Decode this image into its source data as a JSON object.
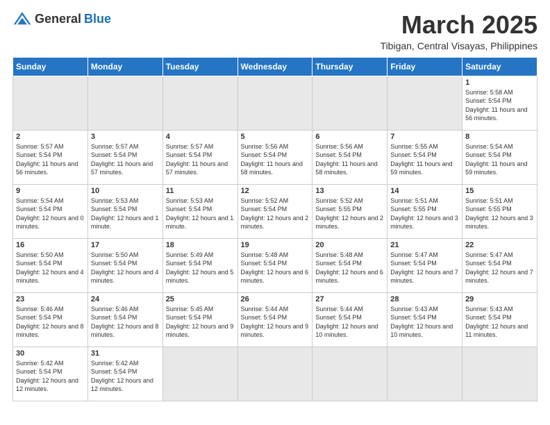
{
  "logo": {
    "general": "General",
    "blue": "Blue"
  },
  "title": "March 2025",
  "subtitle": "Tibigan, Central Visayas, Philippines",
  "weekdays": [
    "Sunday",
    "Monday",
    "Tuesday",
    "Wednesday",
    "Thursday",
    "Friday",
    "Saturday"
  ],
  "weeks": [
    [
      {
        "day": "",
        "empty": true
      },
      {
        "day": "",
        "empty": true
      },
      {
        "day": "",
        "empty": true
      },
      {
        "day": "",
        "empty": true
      },
      {
        "day": "",
        "empty": true
      },
      {
        "day": "",
        "empty": true
      },
      {
        "day": "1",
        "sunrise": "5:58 AM",
        "sunset": "5:54 PM",
        "daylight": "11 hours and 56 minutes."
      }
    ],
    [
      {
        "day": "2",
        "sunrise": "5:57 AM",
        "sunset": "5:54 PM",
        "daylight": "11 hours and 56 minutes."
      },
      {
        "day": "3",
        "sunrise": "5:57 AM",
        "sunset": "5:54 PM",
        "daylight": "11 hours and 57 minutes."
      },
      {
        "day": "4",
        "sunrise": "5:57 AM",
        "sunset": "5:54 PM",
        "daylight": "11 hours and 57 minutes."
      },
      {
        "day": "5",
        "sunrise": "5:56 AM",
        "sunset": "5:54 PM",
        "daylight": "11 hours and 58 minutes."
      },
      {
        "day": "6",
        "sunrise": "5:56 AM",
        "sunset": "5:54 PM",
        "daylight": "11 hours and 58 minutes."
      },
      {
        "day": "7",
        "sunrise": "5:55 AM",
        "sunset": "5:54 PM",
        "daylight": "11 hours and 59 minutes."
      },
      {
        "day": "8",
        "sunrise": "5:54 AM",
        "sunset": "5:54 PM",
        "daylight": "11 hours and 59 minutes."
      }
    ],
    [
      {
        "day": "9",
        "sunrise": "5:54 AM",
        "sunset": "5:54 PM",
        "daylight": "12 hours and 0 minutes."
      },
      {
        "day": "10",
        "sunrise": "5:53 AM",
        "sunset": "5:54 PM",
        "daylight": "12 hours and 1 minute."
      },
      {
        "day": "11",
        "sunrise": "5:53 AM",
        "sunset": "5:54 PM",
        "daylight": "12 hours and 1 minute."
      },
      {
        "day": "12",
        "sunrise": "5:52 AM",
        "sunset": "5:54 PM",
        "daylight": "12 hours and 2 minutes."
      },
      {
        "day": "13",
        "sunrise": "5:52 AM",
        "sunset": "5:55 PM",
        "daylight": "12 hours and 2 minutes."
      },
      {
        "day": "14",
        "sunrise": "5:51 AM",
        "sunset": "5:55 PM",
        "daylight": "12 hours and 3 minutes."
      },
      {
        "day": "15",
        "sunrise": "5:51 AM",
        "sunset": "5:55 PM",
        "daylight": "12 hours and 3 minutes."
      }
    ],
    [
      {
        "day": "16",
        "sunrise": "5:50 AM",
        "sunset": "5:54 PM",
        "daylight": "12 hours and 4 minutes."
      },
      {
        "day": "17",
        "sunrise": "5:50 AM",
        "sunset": "5:54 PM",
        "daylight": "12 hours and 4 minutes."
      },
      {
        "day": "18",
        "sunrise": "5:49 AM",
        "sunset": "5:54 PM",
        "daylight": "12 hours and 5 minutes."
      },
      {
        "day": "19",
        "sunrise": "5:48 AM",
        "sunset": "5:54 PM",
        "daylight": "12 hours and 6 minutes."
      },
      {
        "day": "20",
        "sunrise": "5:48 AM",
        "sunset": "5:54 PM",
        "daylight": "12 hours and 6 minutes."
      },
      {
        "day": "21",
        "sunrise": "5:47 AM",
        "sunset": "5:54 PM",
        "daylight": "12 hours and 7 minutes."
      },
      {
        "day": "22",
        "sunrise": "5:47 AM",
        "sunset": "5:54 PM",
        "daylight": "12 hours and 7 minutes."
      }
    ],
    [
      {
        "day": "23",
        "sunrise": "5:46 AM",
        "sunset": "5:54 PM",
        "daylight": "12 hours and 8 minutes."
      },
      {
        "day": "24",
        "sunrise": "5:46 AM",
        "sunset": "5:54 PM",
        "daylight": "12 hours and 8 minutes."
      },
      {
        "day": "25",
        "sunrise": "5:45 AM",
        "sunset": "5:54 PM",
        "daylight": "12 hours and 9 minutes."
      },
      {
        "day": "26",
        "sunrise": "5:44 AM",
        "sunset": "5:54 PM",
        "daylight": "12 hours and 9 minutes."
      },
      {
        "day": "27",
        "sunrise": "5:44 AM",
        "sunset": "5:54 PM",
        "daylight": "12 hours and 10 minutes."
      },
      {
        "day": "28",
        "sunrise": "5:43 AM",
        "sunset": "5:54 PM",
        "daylight": "12 hours and 10 minutes."
      },
      {
        "day": "29",
        "sunrise": "5:43 AM",
        "sunset": "5:54 PM",
        "daylight": "12 hours and 11 minutes."
      }
    ],
    [
      {
        "day": "30",
        "sunrise": "5:42 AM",
        "sunset": "5:54 PM",
        "daylight": "12 hours and 12 minutes."
      },
      {
        "day": "31",
        "sunrise": "5:42 AM",
        "sunset": "5:54 PM",
        "daylight": "12 hours and 12 minutes."
      },
      {
        "day": "",
        "empty": true
      },
      {
        "day": "",
        "empty": true
      },
      {
        "day": "",
        "empty": true
      },
      {
        "day": "",
        "empty": true
      },
      {
        "day": "",
        "empty": true
      }
    ]
  ]
}
